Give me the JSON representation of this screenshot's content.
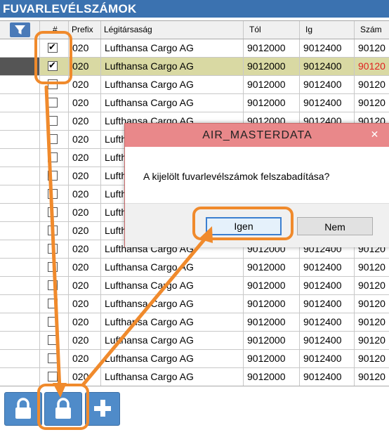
{
  "window": {
    "title": "FUVARLEVÉLSZÁMOK"
  },
  "grid": {
    "columns": [
      "#",
      "Prefix",
      "Légitársaság",
      "Tól",
      "Ig",
      "Szám"
    ],
    "rows": [
      {
        "checked": true,
        "prefix": "020",
        "airline": "Lufthansa Cargo AG",
        "from": "9012000",
        "to": "9012400",
        "num": "90120",
        "selected": false
      },
      {
        "checked": true,
        "prefix": "020",
        "airline": "Lufthansa Cargo AG",
        "from": "9012000",
        "to": "9012400",
        "num": "90120",
        "selected": true
      },
      {
        "checked": false,
        "prefix": "020",
        "airline": "Lufthansa Cargo AG",
        "from": "9012000",
        "to": "9012400",
        "num": "90120",
        "selected": false
      },
      {
        "checked": false,
        "prefix": "020",
        "airline": "Lufthansa Cargo AG",
        "from": "9012000",
        "to": "9012400",
        "num": "90120",
        "selected": false
      },
      {
        "checked": false,
        "prefix": "020",
        "airline": "Lufthansa Cargo AG",
        "from": "9012000",
        "to": "9012400",
        "num": "90120",
        "selected": false
      },
      {
        "checked": false,
        "prefix": "020",
        "airline": "Lufthansa Cargo AG",
        "from": "9012000",
        "to": "9012400",
        "num": "90120",
        "selected": false
      },
      {
        "checked": false,
        "prefix": "020",
        "airline": "Lufthansa Cargo AG",
        "from": "9012000",
        "to": "9012400",
        "num": "90120",
        "selected": false
      },
      {
        "checked": false,
        "prefix": "020",
        "airline": "Lufthansa Cargo AG",
        "from": "9012000",
        "to": "9012400",
        "num": "90120",
        "selected": false
      },
      {
        "checked": false,
        "prefix": "020",
        "airline": "Lufthansa Cargo AG",
        "from": "9012000",
        "to": "9012400",
        "num": "90120",
        "selected": false
      },
      {
        "checked": false,
        "prefix": "020",
        "airline": "Lufthansa Cargo AG",
        "from": "9012000",
        "to": "9012400",
        "num": "90120",
        "selected": false
      },
      {
        "checked": false,
        "prefix": "020",
        "airline": "Lufthansa Cargo AG",
        "from": "9012000",
        "to": "9012400",
        "num": "90120",
        "selected": false
      },
      {
        "checked": false,
        "prefix": "020",
        "airline": "Lufthansa Cargo AG",
        "from": "9012000",
        "to": "9012400",
        "num": "90120",
        "selected": false
      },
      {
        "checked": false,
        "prefix": "020",
        "airline": "Lufthansa Cargo AG",
        "from": "9012000",
        "to": "9012400",
        "num": "90120",
        "selected": false
      },
      {
        "checked": false,
        "prefix": "020",
        "airline": "Lufthansa Cargo AG",
        "from": "9012000",
        "to": "9012400",
        "num": "90120",
        "selected": false
      },
      {
        "checked": false,
        "prefix": "020",
        "airline": "Lufthansa Cargo AG",
        "from": "9012000",
        "to": "9012400",
        "num": "90120",
        "selected": false
      },
      {
        "checked": false,
        "prefix": "020",
        "airline": "Lufthansa Cargo AG",
        "from": "9012000",
        "to": "9012400",
        "num": "90120",
        "selected": false
      },
      {
        "checked": false,
        "prefix": "020",
        "airline": "Lufthansa Cargo AG",
        "from": "9012000",
        "to": "9012400",
        "num": "90120",
        "selected": false
      },
      {
        "checked": false,
        "prefix": "020",
        "airline": "Lufthansa Cargo AG",
        "from": "9012000",
        "to": "9012400",
        "num": "90120",
        "selected": false
      },
      {
        "checked": false,
        "prefix": "020",
        "airline": "Lufthansa Cargo AG",
        "from": "9012000",
        "to": "9012400",
        "num": "90120",
        "selected": false
      }
    ]
  },
  "dialog": {
    "title": "AIR_MASTERDATA",
    "close_glyph": "✕",
    "message": "A kijelölt fuvarlevélszámok felszabadítása?",
    "yes_label": "Igen",
    "no_label": "Nem"
  },
  "toolbar": {
    "icons": [
      "lock-icon",
      "lock-icon",
      "plus-icon"
    ]
  },
  "colors": {
    "title_bar": "#3b72b0",
    "dialog_title": "#e9888a",
    "selected_row": "#d9d9a3",
    "highlight_annotation": "#f08a2c",
    "red_number": "#e02020"
  }
}
